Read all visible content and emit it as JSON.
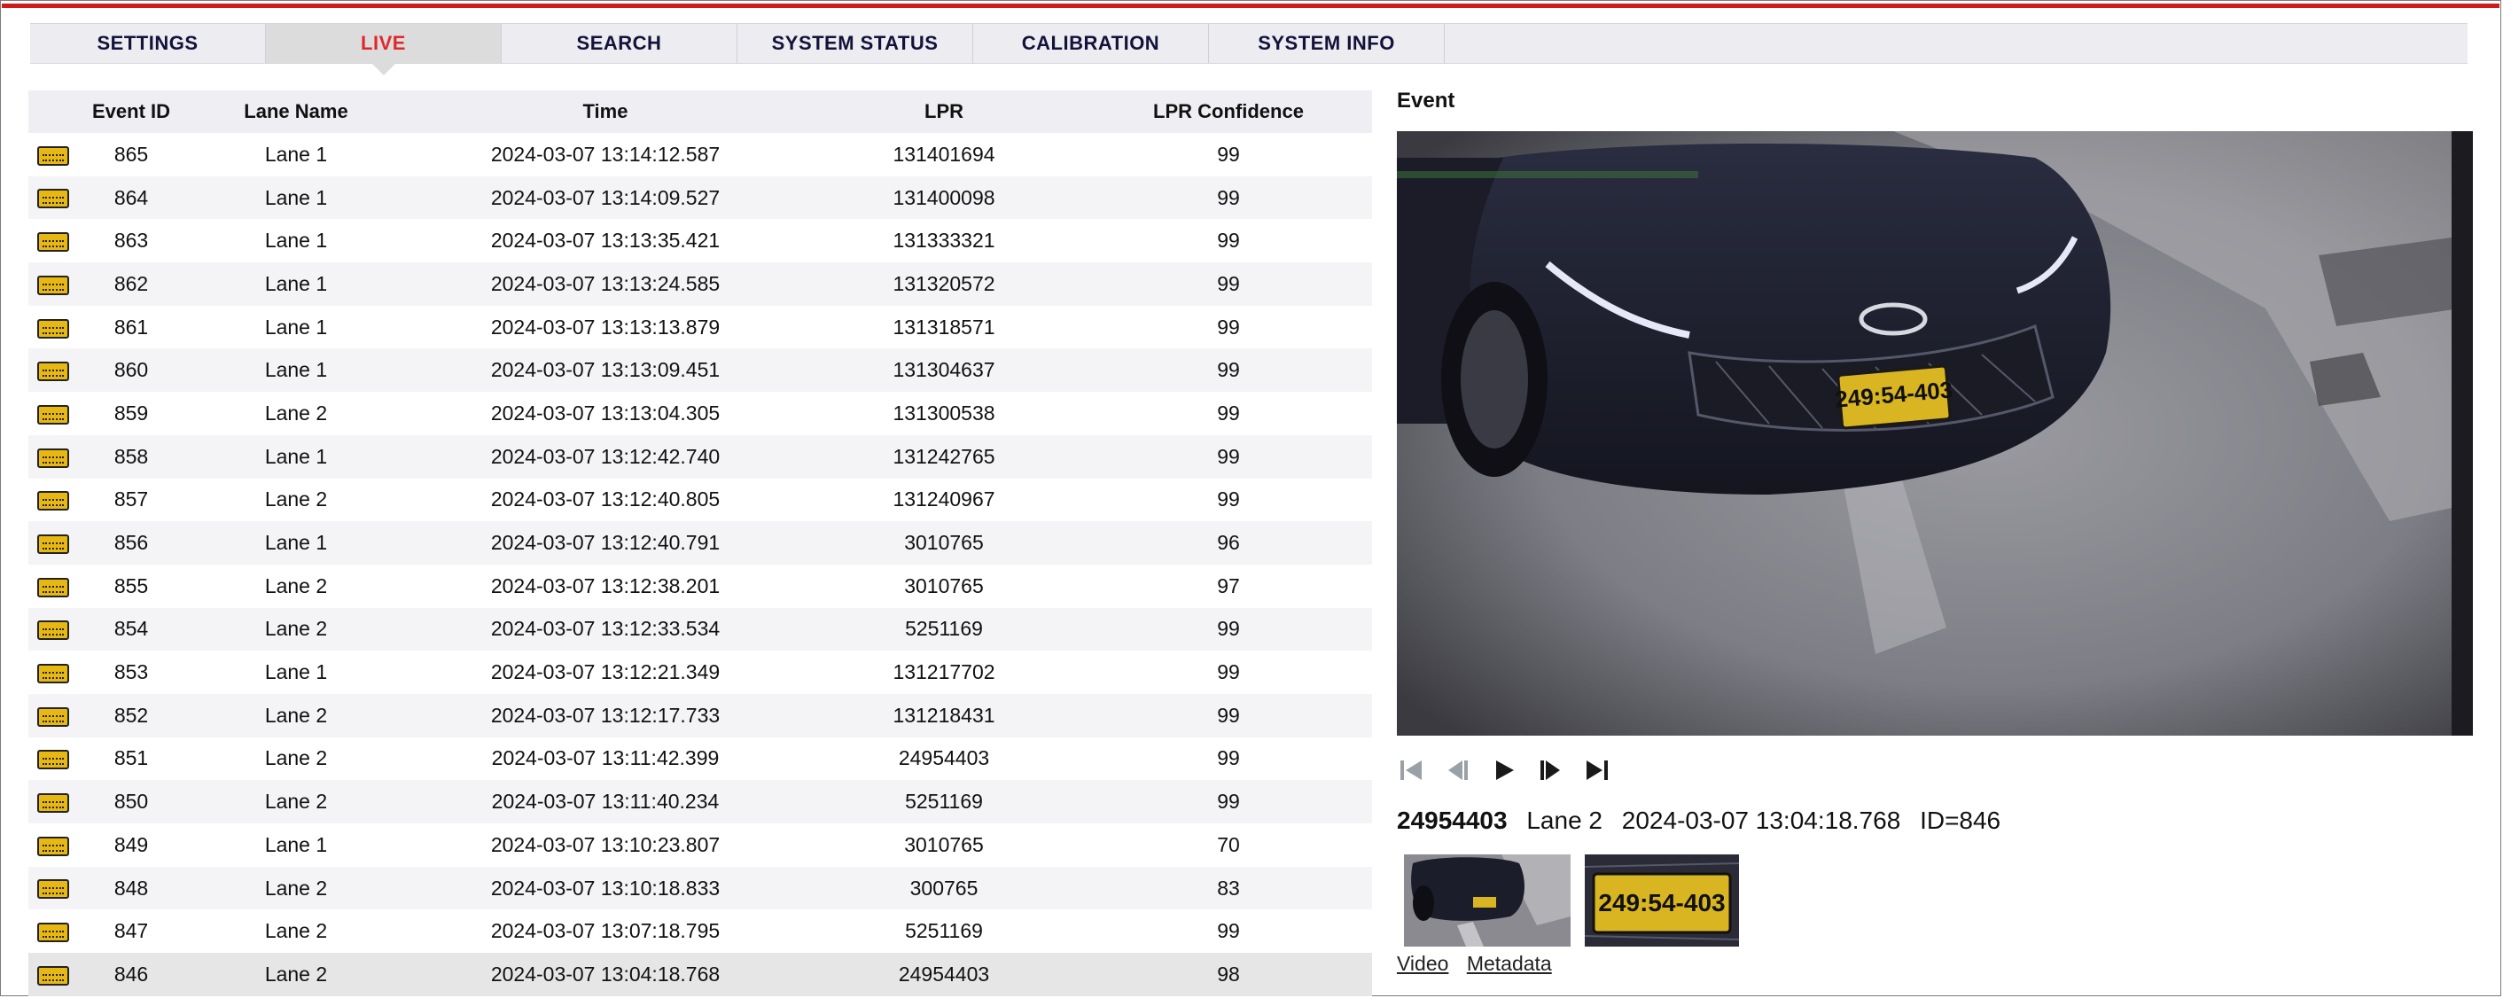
{
  "nav": {
    "tabs": [
      {
        "label": "SETTINGS"
      },
      {
        "label": "LIVE"
      },
      {
        "label": "SEARCH"
      },
      {
        "label": "SYSTEM STATUS"
      },
      {
        "label": "CALIBRATION"
      },
      {
        "label": "SYSTEM INFO"
      }
    ],
    "active": "LIVE",
    "active_color": "#e0282c",
    "accent_line_color": "#d11a1a"
  },
  "table": {
    "headers": {
      "icon": "",
      "event_id": "Event ID",
      "lane": "Lane Name",
      "time": "Time",
      "lpr": "LPR",
      "confidence": "LPR Confidence"
    },
    "row_icon": "license-plate-icon",
    "rows": [
      {
        "id": "865",
        "lane": "Lane 1",
        "time": "2024-03-07 13:14:12.587",
        "lpr": "131401694",
        "conf": "99"
      },
      {
        "id": "864",
        "lane": "Lane 1",
        "time": "2024-03-07 13:14:09.527",
        "lpr": "131400098",
        "conf": "99"
      },
      {
        "id": "863",
        "lane": "Lane 1",
        "time": "2024-03-07 13:13:35.421",
        "lpr": "131333321",
        "conf": "99"
      },
      {
        "id": "862",
        "lane": "Lane 1",
        "time": "2024-03-07 13:13:24.585",
        "lpr": "131320572",
        "conf": "99"
      },
      {
        "id": "861",
        "lane": "Lane 1",
        "time": "2024-03-07 13:13:13.879",
        "lpr": "131318571",
        "conf": "99"
      },
      {
        "id": "860",
        "lane": "Lane 1",
        "time": "2024-03-07 13:13:09.451",
        "lpr": "131304637",
        "conf": "99"
      },
      {
        "id": "859",
        "lane": "Lane 2",
        "time": "2024-03-07 13:13:04.305",
        "lpr": "131300538",
        "conf": "99"
      },
      {
        "id": "858",
        "lane": "Lane 1",
        "time": "2024-03-07 13:12:42.740",
        "lpr": "131242765",
        "conf": "99"
      },
      {
        "id": "857",
        "lane": "Lane 2",
        "time": "2024-03-07 13:12:40.805",
        "lpr": "131240967",
        "conf": "99"
      },
      {
        "id": "856",
        "lane": "Lane 1",
        "time": "2024-03-07 13:12:40.791",
        "lpr": "3010765",
        "conf": "96"
      },
      {
        "id": "855",
        "lane": "Lane 2",
        "time": "2024-03-07 13:12:38.201",
        "lpr": "3010765",
        "conf": "97"
      },
      {
        "id": "854",
        "lane": "Lane 2",
        "time": "2024-03-07 13:12:33.534",
        "lpr": "5251169",
        "conf": "99"
      },
      {
        "id": "853",
        "lane": "Lane 1",
        "time": "2024-03-07 13:12:21.349",
        "lpr": "131217702",
        "conf": "99"
      },
      {
        "id": "852",
        "lane": "Lane 2",
        "time": "2024-03-07 13:12:17.733",
        "lpr": "131218431",
        "conf": "99"
      },
      {
        "id": "851",
        "lane": "Lane 2",
        "time": "2024-03-07 13:11:42.399",
        "lpr": "24954403",
        "conf": "99"
      },
      {
        "id": "850",
        "lane": "Lane 2",
        "time": "2024-03-07 13:11:40.234",
        "lpr": "5251169",
        "conf": "99"
      },
      {
        "id": "849",
        "lane": "Lane 1",
        "time": "2024-03-07 13:10:23.807",
        "lpr": "3010765",
        "conf": "70"
      },
      {
        "id": "848",
        "lane": "Lane 2",
        "time": "2024-03-07 13:10:18.833",
        "lpr": "300765",
        "conf": "83"
      },
      {
        "id": "847",
        "lane": "Lane 2",
        "time": "2024-03-07 13:07:18.795",
        "lpr": "5251169",
        "conf": "99"
      },
      {
        "id": "846",
        "lane": "Lane 2",
        "time": "2024-03-07 13:04:18.768",
        "lpr": "24954403",
        "conf": "98"
      }
    ],
    "selected_id": "846"
  },
  "event": {
    "title": "Event",
    "plate_text": "249:54-403",
    "plate_number": "24954403",
    "lane": "Lane 2",
    "time": "2024-03-07 13:04:18.768",
    "id_label": "ID=846",
    "controls": [
      "skip-first-icon",
      "step-back-icon",
      "play-icon",
      "step-forward-icon",
      "skip-last-icon"
    ],
    "links": {
      "video": "Video",
      "metadata": "Metadata"
    }
  }
}
